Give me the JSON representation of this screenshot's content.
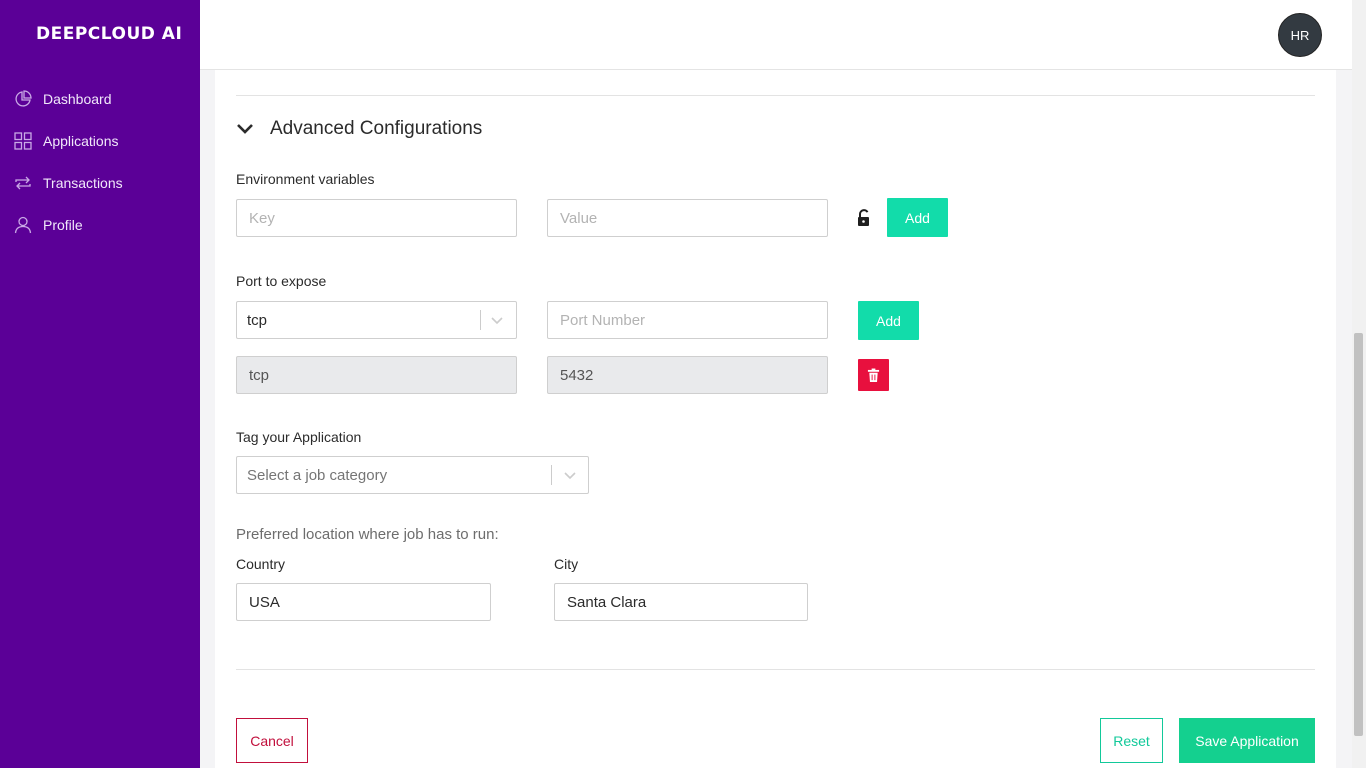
{
  "app": {
    "logo": "DEEPCLOUD AI",
    "colors": {
      "sidebar": "#5b0097",
      "accent": "#12dcaa",
      "danger": "#e8103e",
      "save": "#14d08f"
    }
  },
  "sidebar": {
    "items": [
      {
        "label": "Dashboard",
        "icon": "pie-chart-icon"
      },
      {
        "label": "Applications",
        "icon": "grid-icon"
      },
      {
        "label": "Transactions",
        "icon": "swap-icon"
      },
      {
        "label": "Profile",
        "icon": "user-icon"
      }
    ]
  },
  "header": {
    "avatar_initials": "HR"
  },
  "advanced": {
    "title": "Advanced Configurations",
    "env": {
      "label": "Environment variables",
      "key_placeholder": "Key",
      "value_placeholder": "Value",
      "add_label": "Add"
    },
    "port": {
      "label": "Port to expose",
      "protocol_selected": "tcp",
      "number_placeholder": "Port Number",
      "add_label": "Add",
      "entries": [
        {
          "protocol": "tcp",
          "number": "5432"
        }
      ]
    },
    "tag": {
      "label": "Tag your Application",
      "placeholder": "Select a job category"
    },
    "location": {
      "label": "Preferred location where job has to run:",
      "country_label": "Country",
      "country_value": "USA",
      "city_label": "City",
      "city_value": "Santa Clara"
    }
  },
  "actions": {
    "cancel": "Cancel",
    "reset": "Reset",
    "save": "Save Application"
  }
}
